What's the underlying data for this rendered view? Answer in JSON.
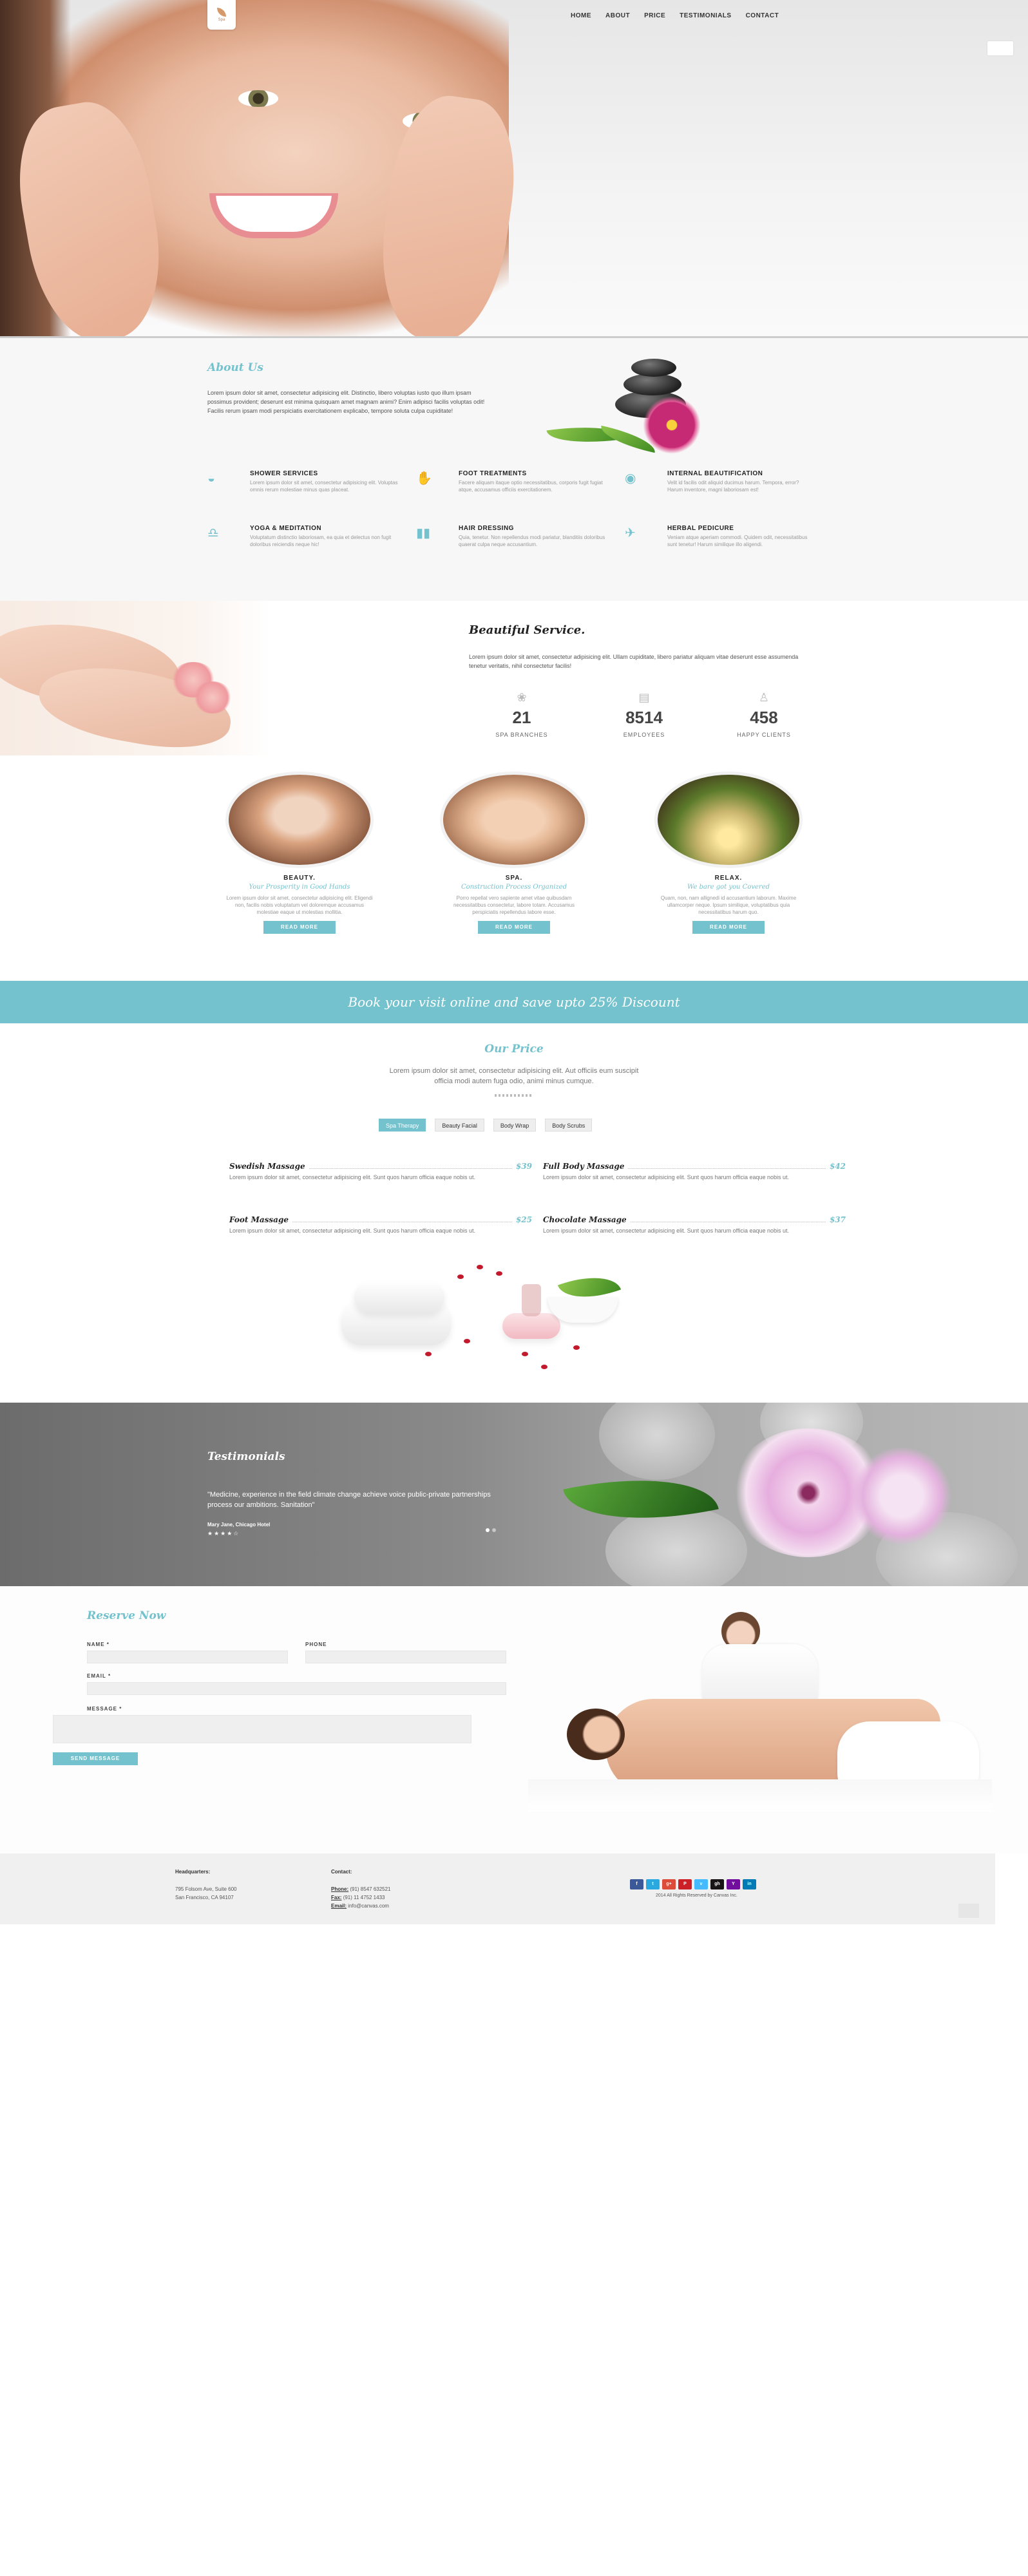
{
  "nav": {
    "items": [
      "HOME",
      "ABOUT",
      "PRICE",
      "TESTIMONIALS",
      "CONTACT"
    ]
  },
  "logo": {
    "text": "Spa"
  },
  "about": {
    "title": "About Us",
    "text": "Lorem ipsum dolor sit amet, consectetur adipisicing elit. Distinctio, libero voluptas iusto quo illum ipsam possimus provident; deserunt est minima quisquam amet magnam animi? Enim adipisci facilis voluptas odit! Facilis rerum ipsam modi perspiciatis exercitationem explicabo, tempore soluta culpa cupiditate!",
    "services": [
      {
        "title": "SHOWER SERVICES",
        "text": "Lorem ipsum dolor sit amet, consectetur adipisicing elit. Voluptas omnis rerum molestiae minus quas placeat."
      },
      {
        "title": "FOOT TREATMENTS",
        "text": "Facere aliquam itaque optio necessitatibus, corporis fugit fugiat atque, accusamus officiis exercitationem."
      },
      {
        "title": "INTERNAL BEAUTIFICATION",
        "text": "Velit id facilis odit aliquid ducimus harum. Tempora, error? Harum inventore, magni laboriosam est!"
      },
      {
        "title": "YOGA & MEDITATION",
        "text": "Voluptatum distinctio laboriosam, ea quia et delectus non fugit doloribus reiciendis neque hic!"
      },
      {
        "title": "HAIR DRESSING",
        "text": "Quia, tenetur. Non repellendus modi pariatur, blanditiis doloribus quaerat culpa neque accusantium."
      },
      {
        "title": "HERBAL PEDICURE",
        "text": "Veniam atque aperiam commodi. Quidem odit, necessitatibus sunt tenetur! Harum similique illo aligendi."
      }
    ]
  },
  "beautiful": {
    "title": "Beautiful Service.",
    "text": "Lorem ipsum dolor sit amet, consectetur adipisicing elit. Ullam cupiditate, libero pariatur aliquam vitae deserunt esse assumenda tenetur veritatis, nihil consectetur facilis!",
    "stats": [
      {
        "value": "21",
        "label": "SPA BRANCHES",
        "icon": "lotus-icon"
      },
      {
        "value": "8514",
        "label": "EMPLOYEES",
        "icon": "chat-icon"
      },
      {
        "value": "458",
        "label": "HAPPY CLIENTS",
        "icon": "meditation-icon"
      }
    ],
    "cards": [
      {
        "title": "BEAUTY.",
        "subtitle": "Your Prosperity in Good Hands",
        "text": "Lorem ipsum dolor sit amet, consectetur adipisicing elit. Eligendi non, facilis nobis voluptatum vel doloremque accusamus molestiae eaque ut molestias mollitia.",
        "button": "READ MORE",
        "color1": "#d9a27f",
        "color2": "#7a4c35"
      },
      {
        "title": "SPA.",
        "subtitle": "Construction Process Organized",
        "text": "Porro repellat vero sapiente amet vitae quibusdam necessitatibus consectetur, labore totam. Accusamus perspiciatis repellendus labore esse.",
        "button": "READ MORE",
        "color1": "#e3b592",
        "color2": "#8e5a3d"
      },
      {
        "title": "RELAX.",
        "subtitle": "We bare got you Covered",
        "text": "Quam, non, nam allignedi id accusantium laborum. Maxime ullamcorper neque. Ipsum similique, voluptatibus quia necessitatibus harum quo.",
        "button": "READ MORE",
        "color1": "#c9b56d",
        "color2": "#3d2a1a"
      }
    ]
  },
  "banner": {
    "text": "Book your visit online and save upto 25% Discount"
  },
  "price": {
    "title": "Our Price",
    "subtitle": "Lorem ipsum dolor sit amet, consectetur adipisicing elit. Aut officiis eum suscipit officia modi autem fuga odio, animi minus cumque.",
    "tabs": [
      "Spa Therapy",
      "Beauty Facial",
      "Body Wrap",
      "Body Scrubs"
    ],
    "items": [
      {
        "name": "Swedish Massage",
        "price": "$39",
        "text": "Lorem ipsum dolor sit amet, consectetur adipisicing elit. Sunt quos harum officia eaque nobis ut."
      },
      {
        "name": "Full Body Massage",
        "price": "$42",
        "text": "Lorem ipsum dolor sit amet, consectetur adipisicing elit. Sunt quos harum officia eaque nobis ut."
      },
      {
        "name": "Foot Massage",
        "price": "$25",
        "text": "Lorem ipsum dolor sit amet, consectetur adipisicing elit. Sunt quos harum officia eaque nobis ut."
      },
      {
        "name": "Chocolate Massage",
        "price": "$37",
        "text": "Lorem ipsum dolor sit amet, consectetur adipisicing elit. Sunt quos harum officia eaque nobis ut."
      }
    ]
  },
  "testimonials": {
    "title": "Testimonials",
    "quote": "\"Medicine, experience in the field climate change achieve voice public-private partnerships process our ambitions. Sanitation\"",
    "author": "Mary Jane, Chicago Hotel",
    "rating": "★★★★☆"
  },
  "reserve": {
    "title": "Reserve Now",
    "name_label": "NAME *",
    "phone_label": "PHONE",
    "email_label": "EMAIL *",
    "message_label": "MESSAGE *",
    "button": "SEND MESSAGE"
  },
  "footer": {
    "hq_title": "Headquarters:",
    "hq_line1": "795 Folsom Ave, Suite 600",
    "hq_line2": "San Francisco, CA 94107",
    "contact_title": "Contact:",
    "phone_label": "Phone:",
    "phone": "(91) 8547 632521",
    "fax_label": "Fax:",
    "fax": "(91) 11 4752 1433",
    "email_label": "Email:",
    "email": "info@canvas.com",
    "copyright": "2014 All Rights Reserved by Canvas Inc.",
    "socials": [
      {
        "label": "f",
        "color": "#3b5998",
        "icon": "facebook-icon"
      },
      {
        "label": "t",
        "color": "#2aa9e0",
        "icon": "twitter-icon"
      },
      {
        "label": "g+",
        "color": "#dd4b39",
        "icon": "google-plus-icon"
      },
      {
        "label": "P",
        "color": "#cb2027",
        "icon": "pinterest-icon"
      },
      {
        "label": "v",
        "color": "#44bbff",
        "icon": "vimeo-icon"
      },
      {
        "label": "gh",
        "color": "#171515",
        "icon": "github-icon"
      },
      {
        "label": "Y",
        "color": "#720e9e",
        "icon": "yahoo-icon"
      },
      {
        "label": "in",
        "color": "#007bb6",
        "icon": "linkedin-icon"
      }
    ]
  }
}
